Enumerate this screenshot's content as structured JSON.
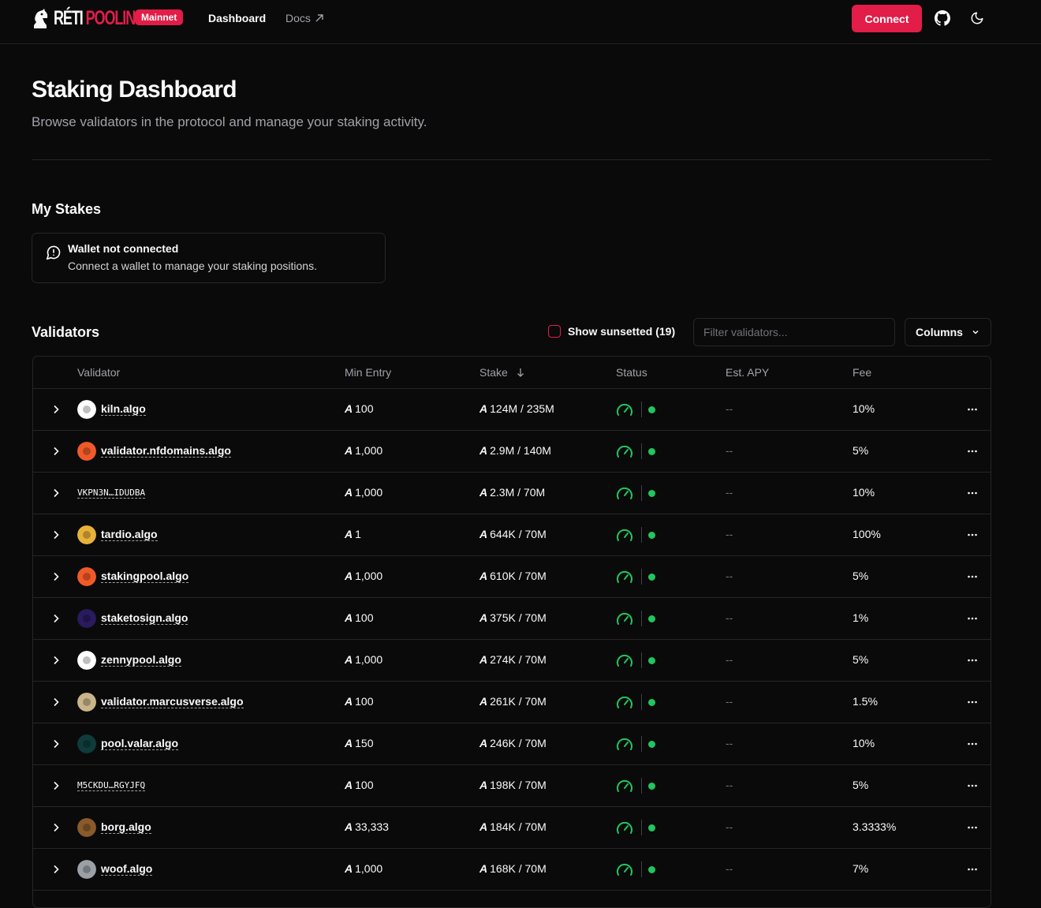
{
  "header": {
    "logo_reti": "RÉTI",
    "logo_pooling": "POOLING",
    "network_badge": "Mainnet",
    "nav": [
      {
        "label": "Dashboard"
      },
      {
        "label": "Docs"
      }
    ],
    "connect_label": "Connect"
  },
  "page": {
    "title": "Staking Dashboard",
    "subtitle": "Browse validators in the protocol and manage your staking activity."
  },
  "my_stakes": {
    "heading": "My Stakes",
    "alert_title": "Wallet not connected",
    "alert_desc": "Connect a wallet to manage your staking positions."
  },
  "validators": {
    "heading": "Validators",
    "show_sunsetted_label": "Show sunsetted (19)",
    "filter_placeholder": "Filter validators...",
    "columns_label": "Columns",
    "headers": {
      "validator": "Validator",
      "min_entry": "Min Entry",
      "stake": "Stake",
      "status": "Status",
      "apy": "Est. APY",
      "fee": "Fee"
    },
    "rows": [
      {
        "name": "kiln.algo",
        "mono": false,
        "min_entry": "100",
        "stake": "124M / 235M",
        "apy": "--",
        "fee": "10%",
        "avatar_color": "#ffffff"
      },
      {
        "name": "validator.nfdomains.algo",
        "mono": false,
        "min_entry": "1,000",
        "stake": "2.9M / 140M",
        "apy": "--",
        "fee": "5%",
        "avatar_color": "#f05a28"
      },
      {
        "name": "VKPN3N…IDUDBA",
        "mono": true,
        "min_entry": "1,000",
        "stake": "2.3M / 70M",
        "apy": "--",
        "fee": "10%",
        "avatar_color": ""
      },
      {
        "name": "tardio.algo",
        "mono": false,
        "min_entry": "1",
        "stake": "644K / 70M",
        "apy": "--",
        "fee": "100%",
        "avatar_color": "#e8b23a"
      },
      {
        "name": "stakingpool.algo",
        "mono": false,
        "min_entry": "1,000",
        "stake": "610K / 70M",
        "apy": "--",
        "fee": "5%",
        "avatar_color": "#f05a28"
      },
      {
        "name": "staketosign.algo",
        "mono": false,
        "min_entry": "100",
        "stake": "375K / 70M",
        "apy": "--",
        "fee": "1%",
        "avatar_color": "#2a1a5e"
      },
      {
        "name": "zennypool.algo",
        "mono": false,
        "min_entry": "1,000",
        "stake": "274K / 70M",
        "apy": "--",
        "fee": "5%",
        "avatar_color": "#ffffff"
      },
      {
        "name": "validator.marcusverse.algo",
        "mono": false,
        "min_entry": "100",
        "stake": "261K / 70M",
        "apy": "--",
        "fee": "1.5%",
        "avatar_color": "#c9b58a"
      },
      {
        "name": "pool.valar.algo",
        "mono": false,
        "min_entry": "150",
        "stake": "246K / 70M",
        "apy": "--",
        "fee": "10%",
        "avatar_color": "#0f3b3b"
      },
      {
        "name": "M5CKDU…RGYJFQ",
        "mono": true,
        "min_entry": "100",
        "stake": "198K / 70M",
        "apy": "--",
        "fee": "5%",
        "avatar_color": ""
      },
      {
        "name": "borg.algo",
        "mono": false,
        "min_entry": "33,333",
        "stake": "184K / 70M",
        "apy": "--",
        "fee": "3.3333%",
        "avatar_color": "#8a5a2b"
      },
      {
        "name": "woof.algo",
        "mono": false,
        "min_entry": "1,000",
        "stake": "168K / 70M",
        "apy": "--",
        "fee": "7%",
        "avatar_color": "#9aa0a6"
      }
    ]
  }
}
